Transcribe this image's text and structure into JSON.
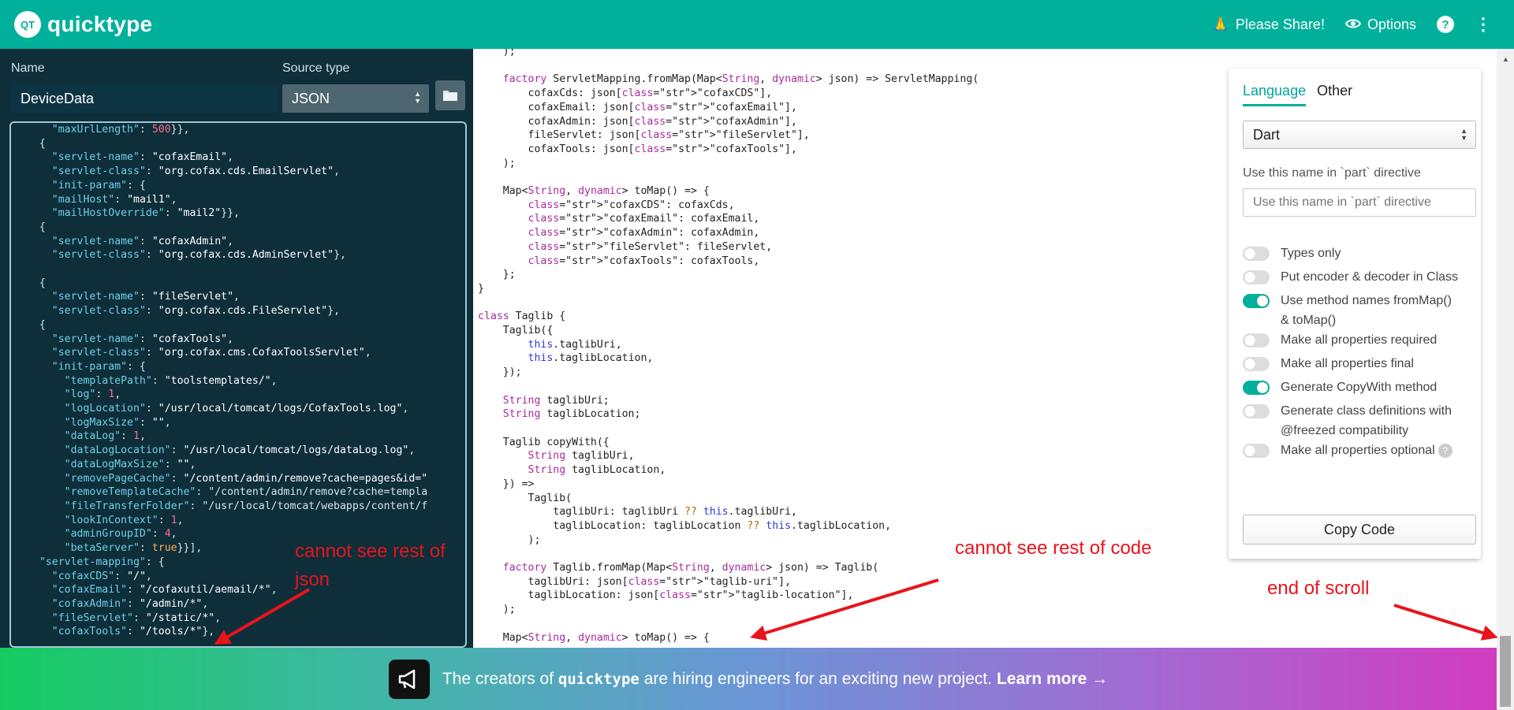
{
  "header": {
    "logo_mark": "QT",
    "app_name": "quicktype",
    "share_label": "Please Share!",
    "options_label": "Options",
    "help_label": "?"
  },
  "left": {
    "name_label": "Name",
    "name_value": "DeviceData",
    "source_type_label": "Source type",
    "source_type_value": "JSON"
  },
  "json_lines": [
    "    \"maxUrlLength\": 500}},",
    "  {",
    "    \"servlet-name\": \"cofaxEmail\",",
    "    \"servlet-class\": \"org.cofax.cds.EmailServlet\",",
    "    \"init-param\": {",
    "    \"mailHost\": \"mail1\",",
    "    \"mailHostOverride\": \"mail2\"}},",
    "  {",
    "    \"servlet-name\": \"cofaxAdmin\",",
    "    \"servlet-class\": \"org.cofax.cds.AdminServlet\"},",
    "",
    "  {",
    "    \"servlet-name\": \"fileServlet\",",
    "    \"servlet-class\": \"org.cofax.cds.FileServlet\"},",
    "  {",
    "    \"servlet-name\": \"cofaxTools\",",
    "    \"servlet-class\": \"org.cofax.cms.CofaxToolsServlet\",",
    "    \"init-param\": {",
    "      \"templatePath\": \"toolstemplates/\",",
    "      \"log\": 1,",
    "      \"logLocation\": \"/usr/local/tomcat/logs/CofaxTools.log\",",
    "      \"logMaxSize\": \"\",",
    "      \"dataLog\": 1,",
    "      \"dataLogLocation\": \"/usr/local/tomcat/logs/dataLog.log\",",
    "      \"dataLogMaxSize\": \"\",",
    "      \"removePageCache\": \"/content/admin/remove?cache=pages&id=\"",
    "      \"removeTemplateCache\": \"/content/admin/remove?cache=templa",
    "      \"fileTransferFolder\": \"/usr/local/tomcat/webapps/content/f",
    "      \"lookInContext\": 1,",
    "      \"adminGroupID\": 4,",
    "      \"betaServer\": true}}],",
    "  \"servlet-mapping\": {",
    "    \"cofaxCDS\": \"/\",",
    "    \"cofaxEmail\": \"/cofaxutil/aemail/*\",",
    "    \"cofaxAdmin\": \"/admin/*\",",
    "    \"fileServlet\": \"/static/*\",",
    "    \"cofaxTools\": \"/tools/*\"},"
  ],
  "code_lines": [
    "    );",
    "",
    "    factory ServletMapping.fromMap(Map<String, dynamic> json) => ServletMapping(",
    "        cofaxCds: json[\"cofaxCDS\"],",
    "        cofaxEmail: json[\"cofaxEmail\"],",
    "        cofaxAdmin: json[\"cofaxAdmin\"],",
    "        fileServlet: json[\"fileServlet\"],",
    "        cofaxTools: json[\"cofaxTools\"],",
    "    );",
    "",
    "    Map<String, dynamic> toMap() => {",
    "        \"cofaxCDS\": cofaxCds,",
    "        \"cofaxEmail\": cofaxEmail,",
    "        \"cofaxAdmin\": cofaxAdmin,",
    "        \"fileServlet\": fileServlet,",
    "        \"cofaxTools\": cofaxTools,",
    "    };",
    "}",
    "",
    "class Taglib {",
    "    Taglib({",
    "        this.taglibUri,",
    "        this.taglibLocation,",
    "    });",
    "",
    "    String taglibUri;",
    "    String taglibLocation;",
    "",
    "    Taglib copyWith({",
    "        String taglibUri,",
    "        String taglibLocation,",
    "    }) =>",
    "        Taglib(",
    "            taglibUri: taglibUri ?? this.taglibUri,",
    "            taglibLocation: taglibLocation ?? this.taglibLocation,",
    "        );",
    "",
    "    factory Taglib.fromMap(Map<String, dynamic> json) => Taglib(",
    "        taglibUri: json[\"taglib-uri\"],",
    "        taglibLocation: json[\"taglib-location\"],",
    "    );",
    "",
    "    Map<String, dynamic> toMap() => {"
  ],
  "options": {
    "tab_language": "Language",
    "tab_other": "Other",
    "language_value": "Dart",
    "part_label": "Use this name in `part` directive",
    "part_placeholder": "Use this name in `part` directive",
    "toggles": [
      {
        "label": "Types only",
        "on": false
      },
      {
        "label": "Put encoder & decoder in Class",
        "on": false
      },
      {
        "label": "Use method names fromMap() & toMap()",
        "on": true
      },
      {
        "label": "Make all properties required",
        "on": false
      },
      {
        "label": "Make all properties final",
        "on": false
      },
      {
        "label": "Generate CopyWith method",
        "on": true
      },
      {
        "label": "Generate class definitions with @freezed compatibility",
        "on": false
      },
      {
        "label": "Make all properties optional",
        "on": false
      }
    ],
    "info_glyph": "?",
    "copy_label": "Copy Code"
  },
  "annotations": {
    "json": "cannot see rest of json",
    "code": "cannot see rest of code",
    "scroll": "end of scroll",
    "color": "#e8141c"
  },
  "banner": {
    "prefix": "The creators of",
    "brand": "quicktype",
    "middle": "are hiring engineers for an exciting new project.",
    "link": "Learn more →"
  },
  "colors": {
    "brand": "#00b09b",
    "editor_bg": "#0e2e3a",
    "json_key": "#6fd0e6",
    "json_number": "#ff6c8c",
    "dart_keyword": "#a72b9e",
    "dart_string": "#c0191a"
  }
}
